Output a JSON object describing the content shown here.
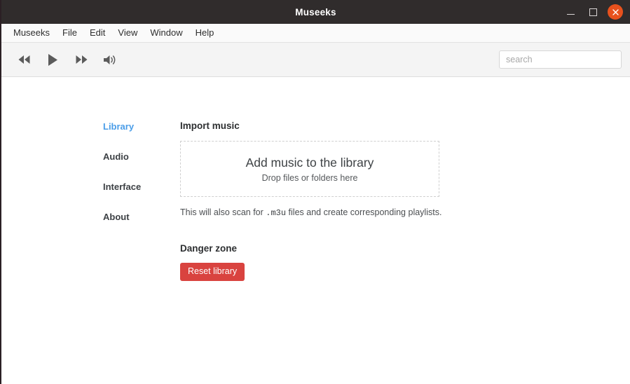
{
  "window": {
    "title": "Museeks",
    "controls": {
      "minimize": "minimize",
      "maximize": "maximize",
      "close": "close"
    }
  },
  "menubar": {
    "items": [
      {
        "label": "Museeks"
      },
      {
        "label": "File"
      },
      {
        "label": "Edit"
      },
      {
        "label": "View"
      },
      {
        "label": "Window"
      },
      {
        "label": "Help"
      }
    ]
  },
  "toolbar": {
    "transport": [
      {
        "name": "previous",
        "label": "Previous"
      },
      {
        "name": "play",
        "label": "Play"
      },
      {
        "name": "next",
        "label": "Next"
      },
      {
        "name": "volume",
        "label": "Volume"
      }
    ],
    "search": {
      "value": "",
      "placeholder": "search"
    }
  },
  "sidebar": {
    "items": [
      {
        "label": "Library",
        "active": true
      },
      {
        "label": "Audio",
        "active": false
      },
      {
        "label": "Interface",
        "active": false
      },
      {
        "label": "About",
        "active": false
      }
    ]
  },
  "main": {
    "import": {
      "heading": "Import music",
      "dropzone_title": "Add music to the library",
      "dropzone_subtitle": "Drop files or folders here",
      "hint_before": "This will also scan for ",
      "hint_code": ".m3u",
      "hint_after": " files and create corresponding playlists."
    },
    "danger": {
      "heading": "Danger zone",
      "reset_label": "Reset library"
    }
  },
  "colors": {
    "titlebar_bg": "#302c2c",
    "close_button": "#e8511d",
    "accent": "#4a9de8",
    "danger": "#d9433f",
    "toolbar_bg": "#f4f4f4"
  }
}
